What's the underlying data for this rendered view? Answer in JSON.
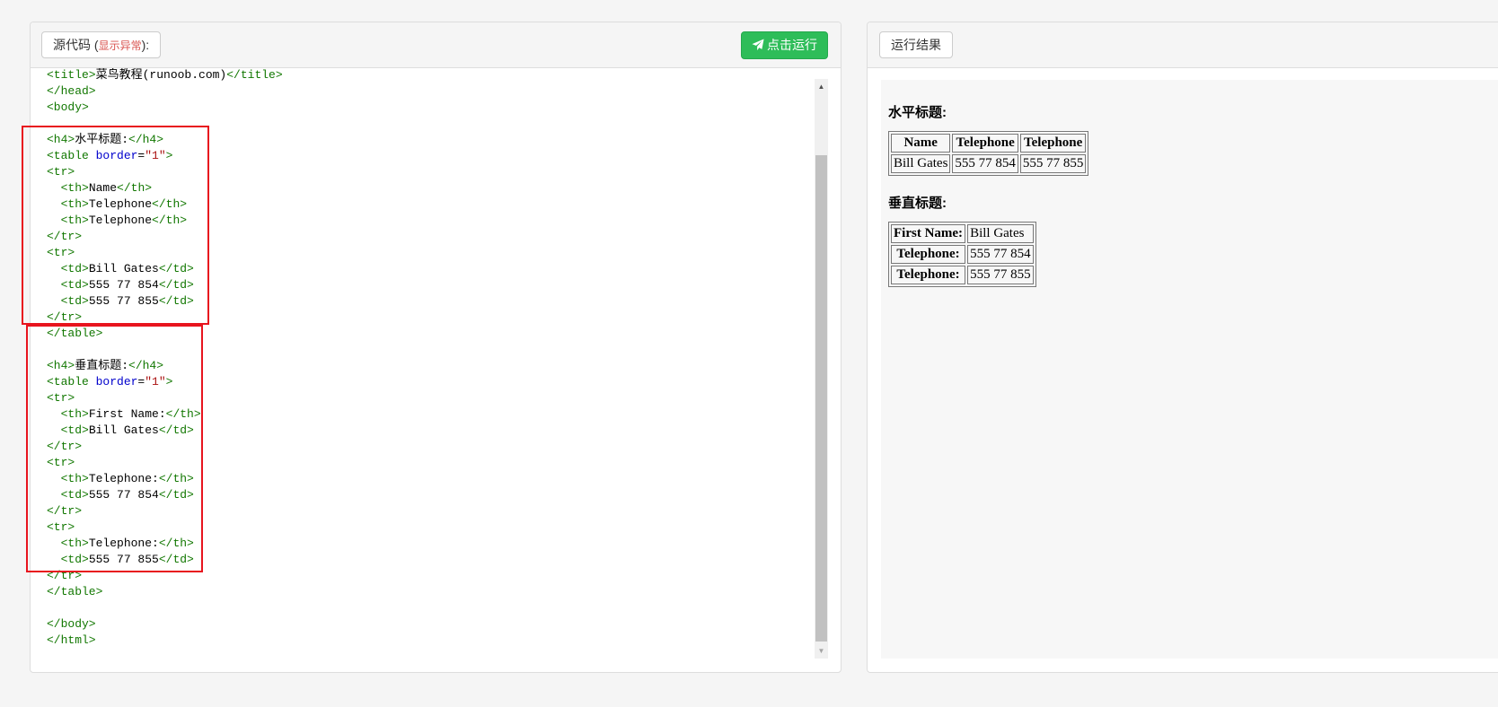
{
  "editor": {
    "source_label": "源代码 (",
    "source_warning": "显示异常",
    "source_suffix": "):",
    "run_label": "点击运行",
    "lines": [
      [
        [
          "t",
          "<title>"
        ],
        [
          "x",
          "菜鸟教程(runoob.com)"
        ],
        [
          "t",
          "</title>"
        ]
      ],
      [
        [
          "t",
          "</head>"
        ]
      ],
      [
        [
          "t",
          "<body>"
        ]
      ],
      [],
      [
        [
          "t",
          "<h4>"
        ],
        [
          "x",
          "水平标题:"
        ],
        [
          "t",
          "</h4>"
        ]
      ],
      [
        [
          "t",
          "<table "
        ],
        [
          "a",
          "border"
        ],
        [
          "x",
          "="
        ],
        [
          "s",
          "\"1\""
        ],
        [
          "t",
          ">"
        ]
      ],
      [
        [
          "t",
          "<tr>"
        ]
      ],
      [
        [
          "x",
          "  "
        ],
        [
          "t",
          "<th>"
        ],
        [
          "x",
          "Name"
        ],
        [
          "t",
          "</th>"
        ]
      ],
      [
        [
          "x",
          "  "
        ],
        [
          "t",
          "<th>"
        ],
        [
          "x",
          "Telephone"
        ],
        [
          "t",
          "</th>"
        ]
      ],
      [
        [
          "x",
          "  "
        ],
        [
          "t",
          "<th>"
        ],
        [
          "x",
          "Telephone"
        ],
        [
          "t",
          "</th>"
        ]
      ],
      [
        [
          "t",
          "</tr>"
        ]
      ],
      [
        [
          "t",
          "<tr>"
        ]
      ],
      [
        [
          "x",
          "  "
        ],
        [
          "t",
          "<td>"
        ],
        [
          "x",
          "Bill Gates"
        ],
        [
          "t",
          "</td>"
        ]
      ],
      [
        [
          "x",
          "  "
        ],
        [
          "t",
          "<td>"
        ],
        [
          "x",
          "555 77 854"
        ],
        [
          "t",
          "</td>"
        ]
      ],
      [
        [
          "x",
          "  "
        ],
        [
          "t",
          "<td>"
        ],
        [
          "x",
          "555 77 855"
        ],
        [
          "t",
          "</td>"
        ]
      ],
      [
        [
          "t",
          "</tr>"
        ]
      ],
      [
        [
          "t",
          "</table>"
        ]
      ],
      [],
      [
        [
          "t",
          "<h4>"
        ],
        [
          "x",
          "垂直标题:"
        ],
        [
          "t",
          "</h4>"
        ]
      ],
      [
        [
          "t",
          "<table "
        ],
        [
          "a",
          "border"
        ],
        [
          "x",
          "="
        ],
        [
          "s",
          "\"1\""
        ],
        [
          "t",
          ">"
        ]
      ],
      [
        [
          "t",
          "<tr>"
        ]
      ],
      [
        [
          "x",
          "  "
        ],
        [
          "t",
          "<th>"
        ],
        [
          "x",
          "First Name:"
        ],
        [
          "t",
          "</th>"
        ]
      ],
      [
        [
          "x",
          "  "
        ],
        [
          "t",
          "<td>"
        ],
        [
          "x",
          "Bill Gates"
        ],
        [
          "t",
          "</td>"
        ]
      ],
      [
        [
          "t",
          "</tr>"
        ]
      ],
      [
        [
          "t",
          "<tr>"
        ]
      ],
      [
        [
          "x",
          "  "
        ],
        [
          "t",
          "<th>"
        ],
        [
          "x",
          "Telephone:"
        ],
        [
          "t",
          "</th>"
        ]
      ],
      [
        [
          "x",
          "  "
        ],
        [
          "t",
          "<td>"
        ],
        [
          "x",
          "555 77 854"
        ],
        [
          "t",
          "</td>"
        ]
      ],
      [
        [
          "t",
          "</tr>"
        ]
      ],
      [
        [
          "t",
          "<tr>"
        ]
      ],
      [
        [
          "x",
          "  "
        ],
        [
          "t",
          "<th>"
        ],
        [
          "x",
          "Telephone:"
        ],
        [
          "t",
          "</th>"
        ]
      ],
      [
        [
          "x",
          "  "
        ],
        [
          "t",
          "<td>"
        ],
        [
          "x",
          "555 77 855"
        ],
        [
          "t",
          "</td>"
        ]
      ],
      [
        [
          "t",
          "</tr>"
        ]
      ],
      [
        [
          "t",
          "</table>"
        ]
      ],
      [],
      [
        [
          "t",
          "</body>"
        ]
      ],
      [
        [
          "t",
          "</html>"
        ]
      ]
    ]
  },
  "result": {
    "tab_label": "运行结果",
    "horizontal": {
      "heading": "水平标题:",
      "headers": [
        "Name",
        "Telephone",
        "Telephone"
      ],
      "row": [
        "Bill Gates",
        "555 77 854",
        "555 77 855"
      ]
    },
    "vertical": {
      "heading": "垂直标题:",
      "rows": [
        {
          "th": "First Name:",
          "td": "Bill Gates"
        },
        {
          "th": "Telephone:",
          "td": "555 77 854"
        },
        {
          "th": "Telephone:",
          "td": "555 77 855"
        }
      ]
    }
  },
  "colors": {
    "run_button": "#2ebd59",
    "highlight_box": "#e8141e",
    "tag": "#117700",
    "attribute": "#0000cc",
    "string": "#aa1111"
  }
}
